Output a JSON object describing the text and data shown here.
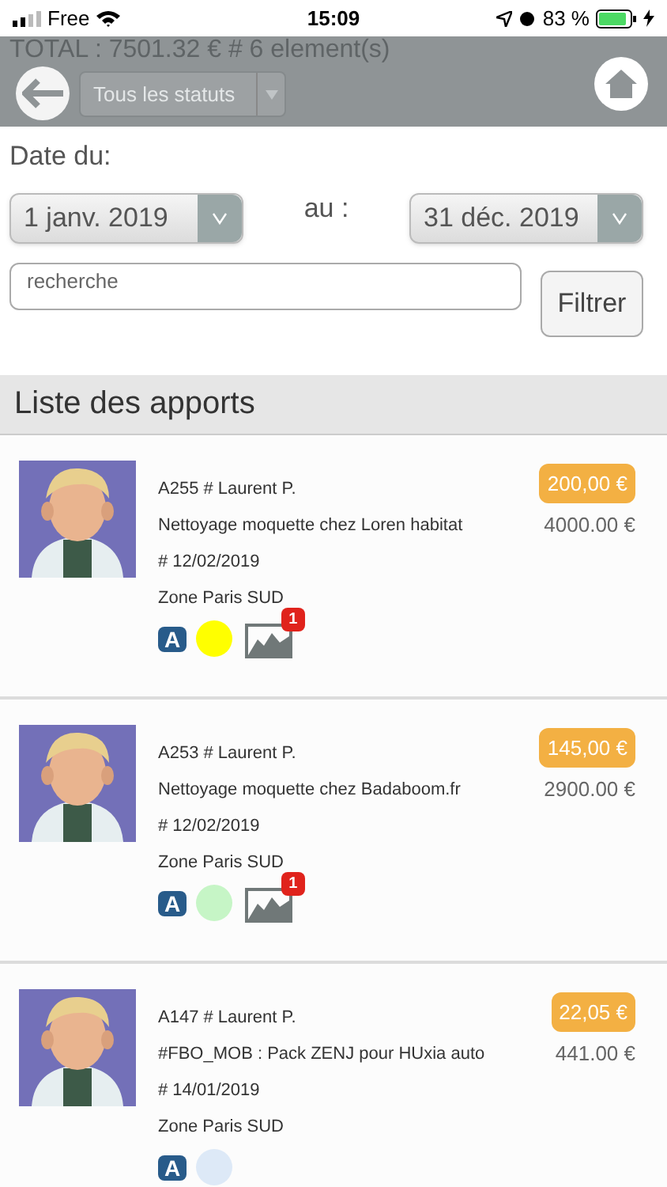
{
  "status_bar": {
    "carrier": "Free",
    "time": "15:09",
    "battery": "83 %"
  },
  "header": {
    "total": "TOTAL : 7501.32 € # 6 element(s)",
    "status_select": "Tous les statuts"
  },
  "filters": {
    "date_label": "Date du:",
    "from": "1 janv. 2019",
    "to_label": "au :",
    "to": "31 déc. 2019",
    "search": {
      "placeholder": "recherche"
    },
    "button": "Filtrer"
  },
  "section_title": "Liste des apports",
  "items": [
    {
      "title": "A255 # Laurent P.",
      "description": "Nettoyage moquette chez Loren habitat",
      "date": "# 12/02/2019",
      "zone": "Zone Paris SUD",
      "commission": "200,00 €",
      "amount": "4000.00 €",
      "tag": "A",
      "color": "#ffff00",
      "photos": "1"
    },
    {
      "title": "A253 # Laurent P.",
      "description": "Nettoyage moquette chez Badaboom.fr",
      "date": "# 12/02/2019",
      "zone": "Zone Paris SUD",
      "commission": "145,00 €",
      "amount": "2900.00 €",
      "tag": "A",
      "color": "#c6f5c6",
      "photos": "1"
    },
    {
      "title": "A147 # Laurent P.",
      "description": "#FBO_MOB : Pack ZENJ pour HUxia auto",
      "date": "# 14/01/2019",
      "zone": "Zone Paris SUD",
      "commission": "22,05 €",
      "amount": "441.00 €",
      "tag": "A",
      "color": "#dde9f7"
    }
  ]
}
